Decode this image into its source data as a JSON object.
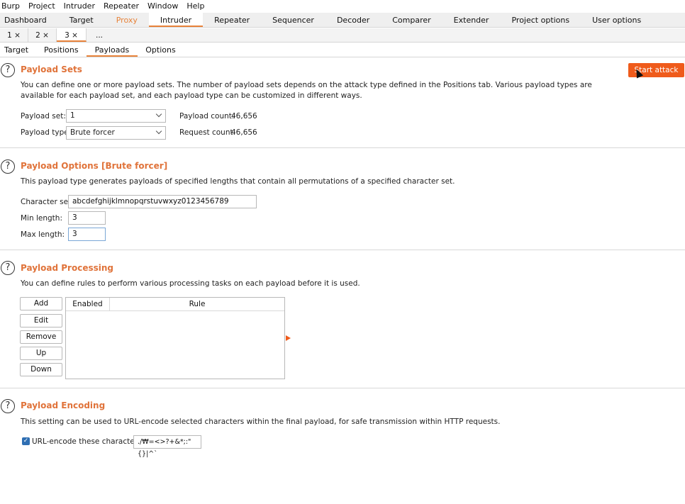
{
  "menu": [
    "Burp",
    "Project",
    "Intruder",
    "Repeater",
    "Window",
    "Help"
  ],
  "main_tabs": [
    "Dashboard",
    "Target",
    "Proxy",
    "Intruder",
    "Repeater",
    "Sequencer",
    "Decoder",
    "Comparer",
    "Extender",
    "Project options",
    "User options"
  ],
  "number_tabs": [
    "1 ×",
    "2 ×",
    "3 ×",
    "..."
  ],
  "sub_tabs": [
    "Target",
    "Positions",
    "Payloads",
    "Options"
  ],
  "start_attack": "Start attack",
  "payload_sets": {
    "title": "Payload Sets",
    "desc": "You can define one or more payload sets. The number of payload sets depends on the attack type defined in the Positions tab. Various payload types are available for each payload set, and each payload type can be customized in different ways.",
    "set_label": "Payload set:",
    "set_value": "1",
    "type_label": "Payload type:",
    "type_value": "Brute forcer",
    "count_label": "Payload count:",
    "count_value": "46,656",
    "request_label": "Request count:",
    "request_value": "46,656"
  },
  "payload_options": {
    "title": "Payload Options [Brute forcer]",
    "desc": "This payload type generates payloads of specified lengths that contain all permutations of a specified character set.",
    "charset_label": "Character set:",
    "charset_value": "abcdefghijklmnopqrstuvwxyz0123456789",
    "min_label": "Min length:",
    "min_value": "3",
    "max_label": "Max length:",
    "max_value": "3"
  },
  "payload_processing": {
    "title": "Payload Processing",
    "desc": "You can define rules to perform various processing tasks on each payload before it is used.",
    "buttons": [
      "Add",
      "Edit",
      "Remove",
      "Up",
      "Down"
    ],
    "columns": [
      "Enabled",
      "Rule"
    ]
  },
  "payload_encoding": {
    "title": "Payload Encoding",
    "desc": "This setting can be used to URL-encode selected characters within the final payload, for safe transmission within HTTP requests.",
    "checkbox_label": "URL-encode these characters:",
    "chars_value": "./₩=<>?+&*;:\"{}|^`"
  },
  "colors": {
    "accent": "#e8833a",
    "title": "#e0733a",
    "button": "#ef5b1b"
  }
}
